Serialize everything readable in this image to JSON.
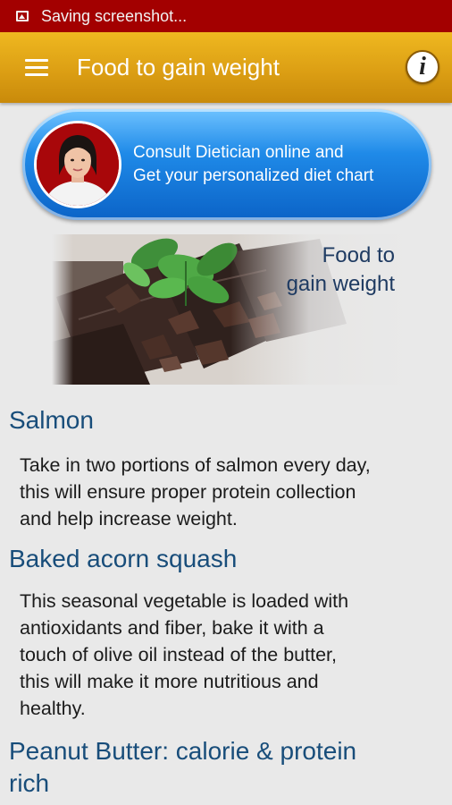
{
  "status_bar": {
    "notification": "Saving screenshot..."
  },
  "app_bar": {
    "title": "Food to gain weight",
    "info_glyph": "i"
  },
  "banner": {
    "line1": "Consult Dietician online and",
    "line2": "Get your personalized diet chart"
  },
  "hero": {
    "title_line1": "Food to",
    "title_line2": "gain weight"
  },
  "sections": [
    {
      "heading": "Salmon",
      "lines": [
        "Take in two portions of salmon every day,",
        "this will ensure proper protein collection",
        "and help increase weight."
      ]
    },
    {
      "heading": "Baked acorn squash",
      "lines": [
        "This seasonal vegetable is loaded with",
        "antioxidants and fiber, bake it with a",
        "touch of olive oil instead of the butter,",
        "this will make it more nutritious and",
        "healthy."
      ]
    },
    {
      "heading_lines": [
        "Peanut Butter: calorie & protein",
        "rich"
      ]
    }
  ],
  "colors": {
    "status_bar": "#a30000",
    "app_bar": "#dc9f14",
    "heading": "#184d7a",
    "banner": "#1f8ae8"
  }
}
